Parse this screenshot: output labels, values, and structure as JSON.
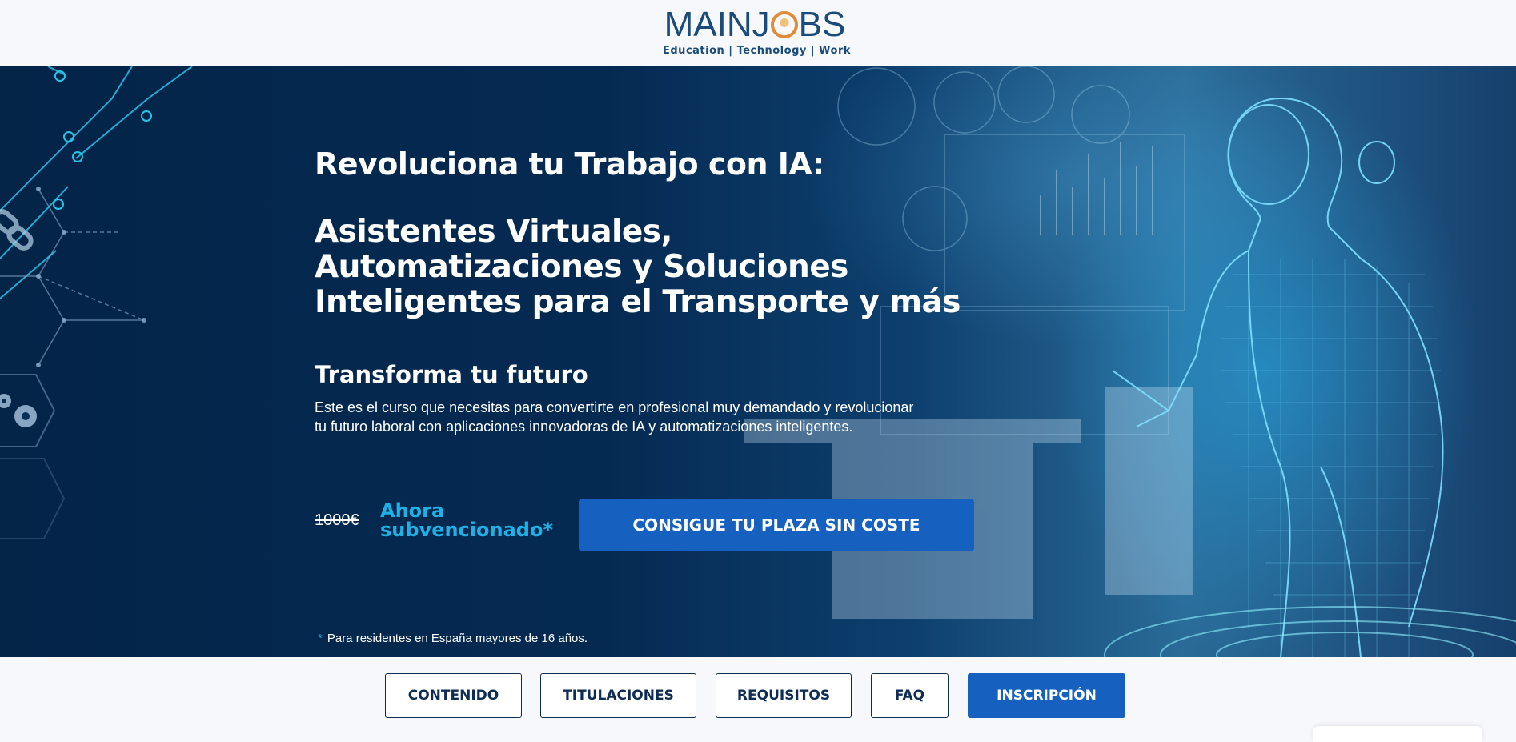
{
  "header": {
    "logo_text_left": "MAINJ",
    "logo_text_right": "BS",
    "logo_tagline": "Education | Technology | Work"
  },
  "hero": {
    "title": "Revoluciona tu Trabajo con IA:",
    "subtitle": "Asistentes Virtuales, Automatizaciones y Soluciones Inteligentes para el Transporte y más",
    "section_title": "Transforma tu futuro",
    "description": "Este es el curso que necesitas para convertirte en profesional muy demandado y revolucionar tu futuro laboral con aplicaciones innovadoras de IA y automatizaciones inteligentes.",
    "old_price": "1000€",
    "offer": "Ahora subvencionado*",
    "cta_label": "CONSIGUE TU PLAZA SIN COSTE",
    "note_asterisk": "*",
    "note": "Para residentes en España mayores de 16 años."
  },
  "nav": {
    "items": [
      {
        "label": "CONTENIDO"
      },
      {
        "label": "TITULACIONES"
      },
      {
        "label": "REQUISITOS"
      },
      {
        "label": "FAQ"
      },
      {
        "label": "INSCRIPCIÓN"
      }
    ]
  },
  "colors": {
    "brand_navy": "#0f2d52",
    "accent_blue": "#1661c0",
    "accent_cyan": "#1fb1e6",
    "logo_orange": "#e08a3c"
  },
  "icons": [
    "circuit-decoration",
    "gear-icon",
    "link-chain-icon",
    "logo-o-icon"
  ]
}
